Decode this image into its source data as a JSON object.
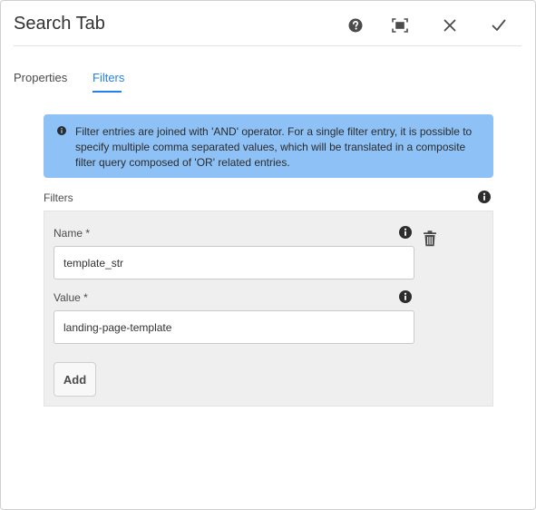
{
  "dialog": {
    "title": "Search Tab",
    "actions": [
      {
        "name": "help",
        "icon": "help-icon"
      },
      {
        "name": "fullscreen",
        "icon": "fullscreen-icon"
      },
      {
        "name": "close",
        "icon": "close-icon"
      },
      {
        "name": "done",
        "icon": "checkmark-icon"
      }
    ]
  },
  "tabs": [
    {
      "label": "Properties",
      "active": false
    },
    {
      "label": "Filters",
      "active": true
    }
  ],
  "alert": {
    "icon": "info-icon",
    "text": "Filter entries are joined with 'AND' operator. For a single filter entry, it is possible to specify multiple comma separated values, which will be translated in a composite filter query composed of 'OR' related entries."
  },
  "filters": {
    "label": "Filters",
    "entry": {
      "name_label": "Name *",
      "name_value": "template_str",
      "value_label": "Value *",
      "value_value": "landing-page-template",
      "delete_icon": "trash-icon"
    },
    "add_label": "Add"
  },
  "colors": {
    "accent": "#2680eb",
    "alert_bg": "#8ec1f6",
    "panel_bg": "#efefef"
  }
}
